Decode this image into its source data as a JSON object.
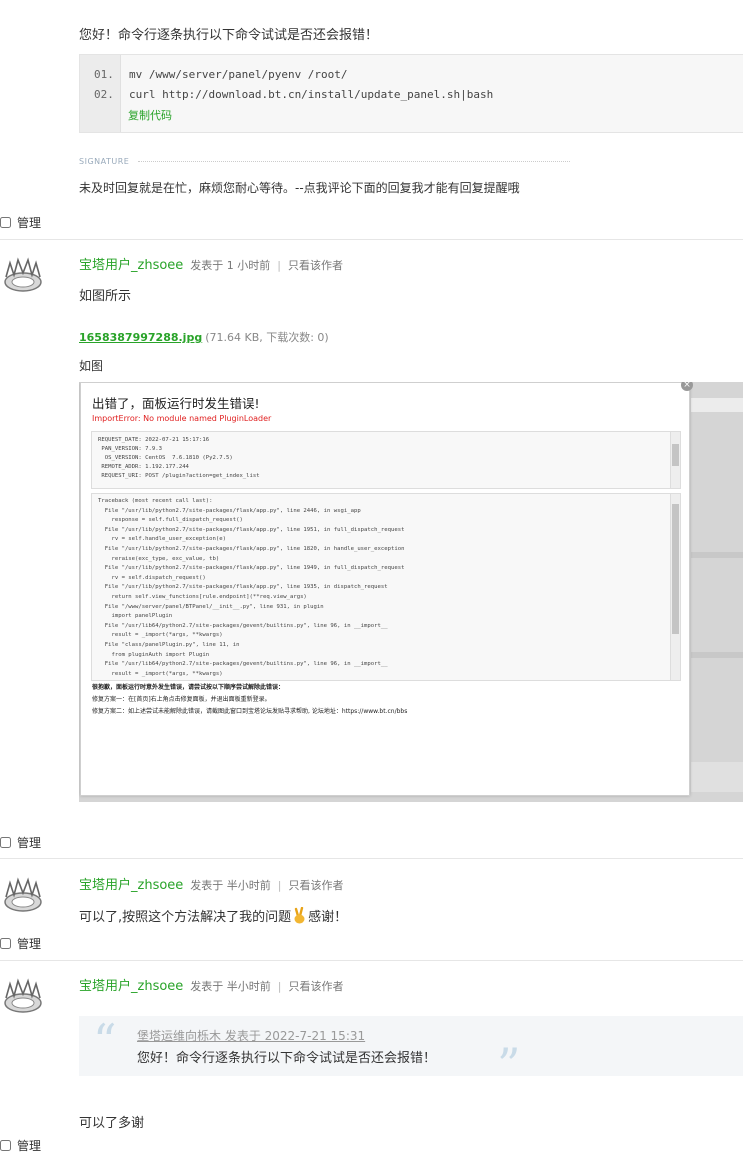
{
  "post0": {
    "text": "您好！命令行逐条执行以下命令试试是否还会报错！",
    "code": {
      "lines": [
        {
          "num": "01.",
          "code": "mv /www/server/panel/pyenv /root/"
        },
        {
          "num": "02.",
          "code": "curl http://download.bt.cn/install/update_panel.sh|bash"
        }
      ],
      "copy_label": "复制代码"
    },
    "signature_label": "SIGNATURE",
    "signature": "未及时回复就是在忙，麻烦您耐心等待。--点我评论下面的回复我才能有回复提醒哦"
  },
  "manage_label": "管理",
  "posts": [
    {
      "author": "宝塔用户_zhsoee",
      "meta": "发表于 1 小时前",
      "sep": "|",
      "only_author": "只看该作者",
      "text": "如图所示",
      "attachment": {
        "name": "1658387997288.jpg",
        "info": "(71.64 KB, 下载次数: 0)"
      },
      "caption": "如图"
    },
    {
      "author": "宝塔用户_zhsoee",
      "meta": "发表于 半小时前",
      "sep": "|",
      "only_author": "只看该作者",
      "text": "可以了,按照这个方法解决了我的问题",
      "text_after": "感谢！"
    },
    {
      "author": "宝塔用户_zhsoee",
      "meta": "发表于 半小时前",
      "sep": "|",
      "only_author": "只看该作者",
      "quote": {
        "head": "堡塔运维向栎木 发表于 2022-7-21 15:31",
        "body": "您好！命令行逐条执行以下命令试试是否还会报错！"
      },
      "text": "可以了多谢"
    }
  ],
  "screenshot": {
    "title": "出错了，面板运行时发生错误!",
    "error": "ImportError: No module named PluginLoader",
    "close": "×",
    "info_lines": [
      "REQUEST_DATE: 2022-07-21 15:17:16",
      " PAN_VERSION: 7.9.3",
      "  OS_VERSION: CentOS  7.6.1810 (Py2.7.5)",
      " REMOTE_ADDR: 1.192.177.244",
      " REQUEST_URI: POST /plugin?action=get_index_list"
    ],
    "trace_lines": [
      "Traceback (most recent call last):",
      "  File \"/usr/lib/python2.7/site-packages/flask/app.py\", line 2446, in wsgi_app",
      "    response = self.full_dispatch_request()",
      "  File \"/usr/lib/python2.7/site-packages/flask/app.py\", line 1951, in full_dispatch_request",
      "    rv = self.handle_user_exception(e)",
      "  File \"/usr/lib/python2.7/site-packages/flask/app.py\", line 1820, in handle_user_exception",
      "    reraise(exc_type, exc_value, tb)",
      "  File \"/usr/lib/python2.7/site-packages/flask/app.py\", line 1949, in full_dispatch_request",
      "    rv = self.dispatch_request()",
      "  File \"/usr/lib/python2.7/site-packages/flask/app.py\", line 1935, in dispatch_request",
      "    return self.view_functions[rule.endpoint](**req.view_args)",
      "  File \"/www/server/panel/BTPanel/__init__.py\", line 931, in plugin",
      "    import panelPlugin",
      "  File \"/usr/lib64/python2.7/site-packages/gevent/builtins.py\", line 96, in __import__",
      "    result = _import(*args, **kwargs)",
      "  File \"class/panelPlugin.py\", line 11, in",
      "    from pluginAuth import Plugin",
      "  File \"/usr/lib64/python2.7/site-packages/gevent/builtins.py\", line 96, in __import__",
      "    result = _import(*args, **kwargs)"
    ],
    "fix_lines": [
      "很抱歉，面板运行时意外发生错误，请尝试按以下顺序尝试解除此错误：",
      "修复方案一：在[首页]右上角点击修复面板，并退出面板重新登录。",
      "修复方案二：如上述尝试未能解除此错误，请截图此窗口到宝塔论坛发贴寻求帮助, 论坛地址：https://www.bt.cn/bbs"
    ]
  }
}
